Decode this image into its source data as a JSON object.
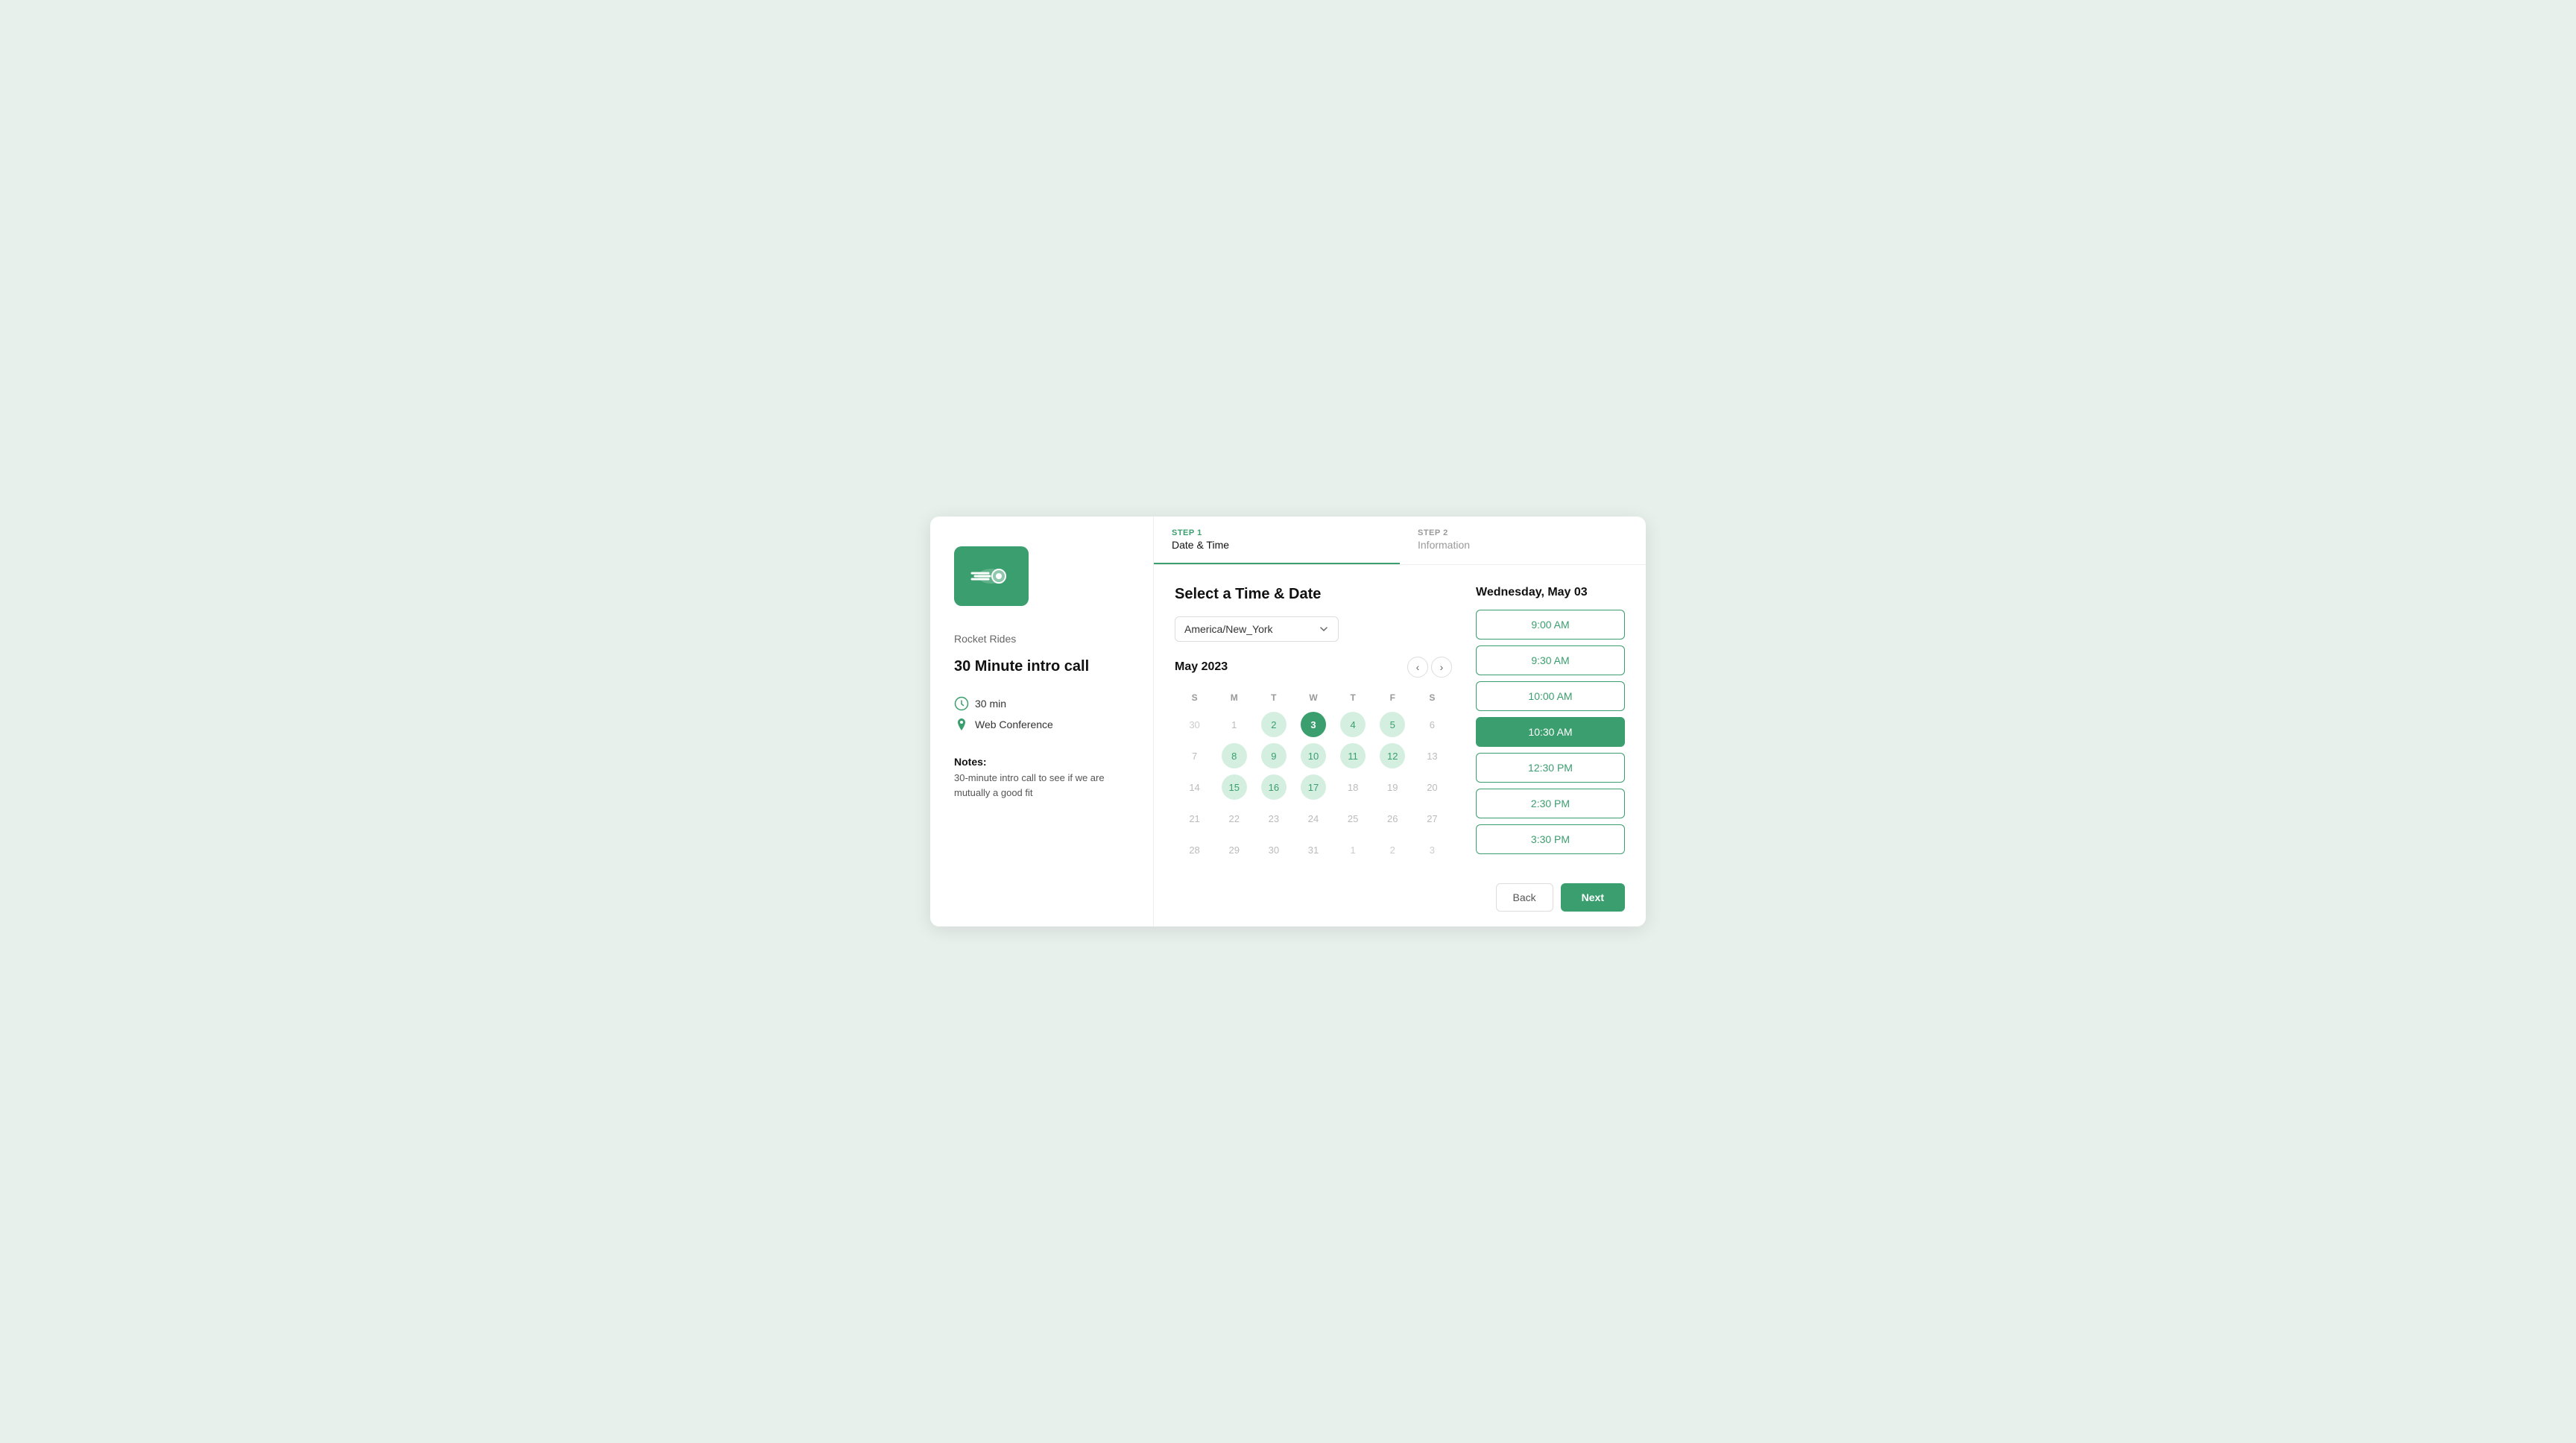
{
  "app": {
    "background_color": "#e8f0ec"
  },
  "sidebar": {
    "company_name": "Rocket Rides",
    "event_title": "30 Minute intro call",
    "duration": "30 min",
    "location": "Web Conference",
    "notes_label": "Notes:",
    "notes_text": "30-minute intro call to see if we are mutually a good fit",
    "logo_alt": "rocket-rides-logo"
  },
  "steps": [
    {
      "number": "STEP 1",
      "name": "Date & Time",
      "active": true
    },
    {
      "number": "STEP 2",
      "name": "Information",
      "active": false
    }
  ],
  "calendar": {
    "section_title": "Select a Time & Date",
    "timezone": "America/New_York",
    "timezone_dropdown_icon": "chevron-down",
    "month_label": "May 2023",
    "days_of_week": [
      "S",
      "M",
      "T",
      "W",
      "T",
      "F",
      "S"
    ],
    "prev_nav_label": "‹",
    "next_nav_label": "›",
    "weeks": [
      [
        {
          "day": "30",
          "state": "other-month"
        },
        {
          "day": "1",
          "state": "inactive"
        },
        {
          "day": "2",
          "state": "available"
        },
        {
          "day": "3",
          "state": "selected"
        },
        {
          "day": "4",
          "state": "available"
        },
        {
          "day": "5",
          "state": "available"
        },
        {
          "day": "6",
          "state": "inactive"
        }
      ],
      [
        {
          "day": "7",
          "state": "inactive"
        },
        {
          "day": "8",
          "state": "available"
        },
        {
          "day": "9",
          "state": "available"
        },
        {
          "day": "10",
          "state": "available"
        },
        {
          "day": "11",
          "state": "available"
        },
        {
          "day": "12",
          "state": "available"
        },
        {
          "day": "13",
          "state": "inactive"
        }
      ],
      [
        {
          "day": "14",
          "state": "inactive"
        },
        {
          "day": "15",
          "state": "available"
        },
        {
          "day": "16",
          "state": "available"
        },
        {
          "day": "17",
          "state": "available"
        },
        {
          "day": "18",
          "state": "inactive"
        },
        {
          "day": "19",
          "state": "inactive"
        },
        {
          "day": "20",
          "state": "inactive"
        }
      ],
      [
        {
          "day": "21",
          "state": "inactive"
        },
        {
          "day": "22",
          "state": "inactive"
        },
        {
          "day": "23",
          "state": "inactive"
        },
        {
          "day": "24",
          "state": "inactive"
        },
        {
          "day": "25",
          "state": "inactive"
        },
        {
          "day": "26",
          "state": "inactive"
        },
        {
          "day": "27",
          "state": "inactive"
        }
      ],
      [
        {
          "day": "28",
          "state": "inactive"
        },
        {
          "day": "29",
          "state": "inactive"
        },
        {
          "day": "30",
          "state": "inactive"
        },
        {
          "day": "31",
          "state": "inactive"
        },
        {
          "day": "1",
          "state": "other-month"
        },
        {
          "day": "2",
          "state": "other-month"
        },
        {
          "day": "3",
          "state": "other-month"
        }
      ]
    ]
  },
  "time_panel": {
    "date_label": "Wednesday, May 03",
    "slots": [
      {
        "time": "9:00 AM",
        "selected": false
      },
      {
        "time": "9:30 AM",
        "selected": false
      },
      {
        "time": "10:00 AM",
        "selected": false
      },
      {
        "time": "10:30 AM",
        "selected": true
      },
      {
        "time": "12:30 PM",
        "selected": false
      },
      {
        "time": "2:30 PM",
        "selected": false
      },
      {
        "time": "3:30 PM",
        "selected": false
      }
    ]
  },
  "footer": {
    "back_label": "Back",
    "next_label": "Next"
  }
}
